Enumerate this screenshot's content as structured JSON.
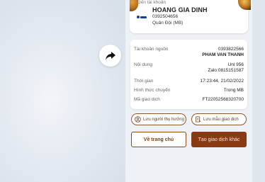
{
  "share": {
    "icon": "share-arrow-icon"
  },
  "recipient": {
    "label": "Đến tài khoản",
    "name": "HOANG GIA DINH",
    "account": "0392504656",
    "bank": "Quân Đội (MB)",
    "bank_icon": "mb-bank-logo-icon"
  },
  "details": {
    "source_label": "Tài khoản nguồn",
    "source_account": "0393822566",
    "source_name": "PHAM VAN THANH",
    "content_label": "Nội dung",
    "content_line1": "Unl 956",
    "content_line2": "Zalo:0815151587",
    "time_label": "Thời gian",
    "time_value": "17:23:44, 21/02/2022",
    "method_label": "Hình thức chuyển",
    "method_value": "Trong MB",
    "code_label": "Mã giao dịch",
    "code_value": "FT22052568320700"
  },
  "actions": {
    "save_beneficiary": "Lưu người thụ hưởng",
    "save_template": "Lưu mẫu giao dịch",
    "home": "Về trang chủ",
    "new_transaction": "Tạo giao dịch khác"
  },
  "colors": {
    "accent": "#8a3a12",
    "bank_blue": "#1c3f95",
    "background": "#eef1f6"
  }
}
